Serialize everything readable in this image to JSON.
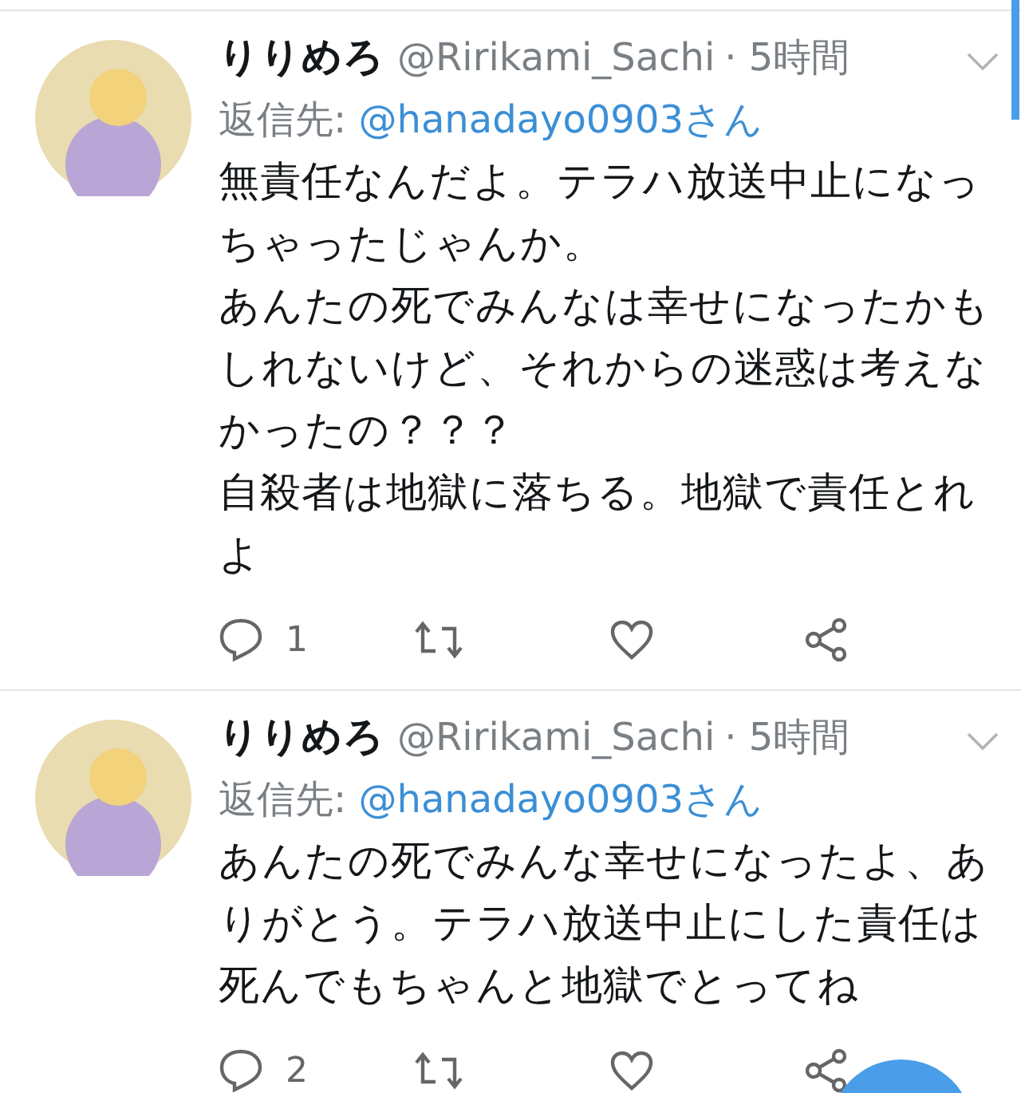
{
  "tweets": [
    {
      "name": "りりめろ",
      "handle": "@Ririkami_Sachi",
      "time": "· 5時間",
      "reply_label": "返信先:",
      "reply_to": "@hanadayo0903さん",
      "body": [
        "無責任なんだよ。テラハ放送中止になっちゃったじゃんか。",
        "あんたの死でみんなは幸せになったかもしれないけど、それからの迷惑は考えなかったの？？？",
        "自殺者は地獄に落ちる。地獄で責任とれよ"
      ],
      "reply_count": "1"
    },
    {
      "name": "りりめろ",
      "handle": "@Ririkami_Sachi",
      "time": "· 5時間",
      "reply_label": "返信先:",
      "reply_to": "@hanadayo0903さん",
      "body": [
        "あんたの死でみんな幸せになったよ、ありがとう。テラハ放送中止にした責任は死んでもちゃんと地獄でとってね"
      ],
      "reply_count": "2"
    }
  ]
}
